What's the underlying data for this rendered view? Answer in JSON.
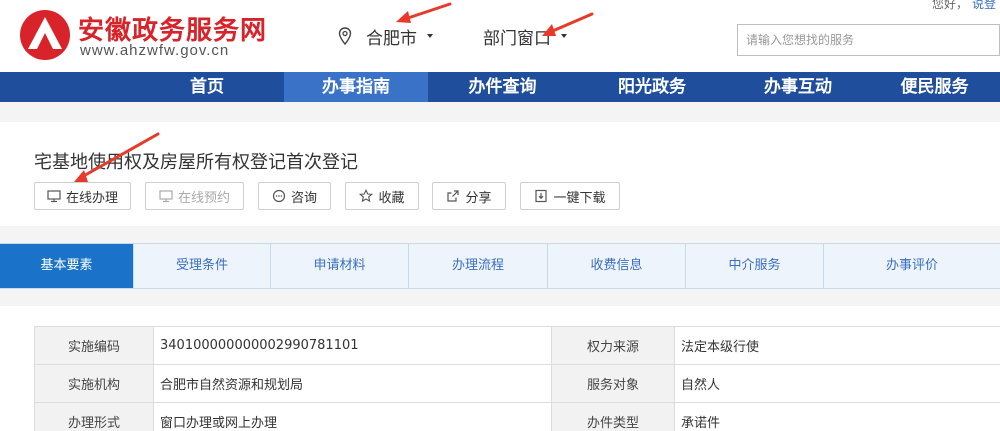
{
  "header": {
    "site_title": "安徽政务服务网",
    "site_url": "www.ahzwfw.gov.cn",
    "city": "合肥市",
    "department": "部门窗口",
    "search_placeholder": "请输入您想找的服务",
    "greeting": "您好，",
    "login": "说登"
  },
  "nav": {
    "items": [
      {
        "label": "首页"
      },
      {
        "label": "办事指南"
      },
      {
        "label": "办件查询"
      },
      {
        "label": "阳光政务"
      },
      {
        "label": "办事互动"
      },
      {
        "label": "便民服务"
      }
    ],
    "active_index": 1
  },
  "item": {
    "title": "宅基地使用权及房屋所有权登记首次登记"
  },
  "actions": [
    {
      "label": "在线办理",
      "icon": "monitor-icon",
      "enabled": true
    },
    {
      "label": "在线预约",
      "icon": "monitor-icon",
      "enabled": false
    },
    {
      "label": "咨询",
      "icon": "chat-icon",
      "enabled": true
    },
    {
      "label": "收藏",
      "icon": "star-icon",
      "enabled": true
    },
    {
      "label": "分享",
      "icon": "share-icon",
      "enabled": true
    },
    {
      "label": "一键下载",
      "icon": "download-icon",
      "enabled": true
    }
  ],
  "tabs": {
    "items": [
      {
        "label": "基本要素"
      },
      {
        "label": "受理条件"
      },
      {
        "label": "申请材料"
      },
      {
        "label": "办理流程"
      },
      {
        "label": "收费信息"
      },
      {
        "label": "中介服务"
      },
      {
        "label": "办事评价"
      }
    ],
    "active_index": 0
  },
  "info": {
    "rows": [
      {
        "l1": "实施编码",
        "v1": "340100000000002990781101",
        "l2": "权力来源",
        "v2": "法定本级行使"
      },
      {
        "l1": "实施机构",
        "v1": "合肥市自然资源和规划局",
        "l2": "服务对象",
        "v2": "自然人"
      },
      {
        "l1": "办理形式",
        "v1": "窗口办理或网上办理",
        "l2": "办件类型",
        "v2": "承诺件"
      }
    ]
  },
  "colors": {
    "brand_red": "#d8232a",
    "nav_blue": "#1f4e9c",
    "nav_active": "#3a72c8",
    "tab_active": "#1a73c8",
    "annotation_arrow": "#e8392a"
  }
}
